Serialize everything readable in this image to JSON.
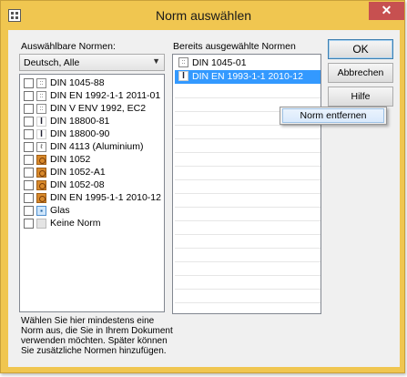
{
  "window": {
    "title": "Norm auswählen",
    "close_glyph": "✕"
  },
  "left_panel": {
    "label": "Auswählbare Normen:",
    "filter": {
      "value": "Deutsch, Alle"
    },
    "items": [
      {
        "label": "DIN 1045-88",
        "icon": "concrete-norm-icon"
      },
      {
        "label": "DIN EN 1992-1-1 2011-01",
        "icon": "concrete-norm-icon"
      },
      {
        "label": "DIN V ENV 1992, EC2",
        "icon": "concrete-norm-icon"
      },
      {
        "label": "DIN 18800-81",
        "icon": "steel-norm-icon"
      },
      {
        "label": "DIN 18800-90",
        "icon": "steel-norm-icon"
      },
      {
        "label": "DIN 4113 (Aluminium)",
        "icon": "aluminium-norm-icon"
      },
      {
        "label": "DIN 1052",
        "icon": "timber-norm-icon"
      },
      {
        "label": "DIN 1052-A1",
        "icon": "timber-norm-icon"
      },
      {
        "label": "DIN 1052-08",
        "icon": "timber-norm-icon"
      },
      {
        "label": "DIN EN 1995-1-1 2010-12",
        "icon": "timber-norm-icon"
      },
      {
        "label": "Glas",
        "icon": "glass-norm-icon"
      },
      {
        "label": "Keine Norm",
        "icon": "no-norm-icon"
      }
    ],
    "help_text": "Wählen Sie hier mindestens eine Norm aus, die Sie in Ihrem Dokument verwenden möchten. Später können Sie zusätzliche Normen hinzufügen."
  },
  "right_panel": {
    "label": "Bereits ausgewählte Normen",
    "items": [
      {
        "label": "DIN 1045-01",
        "icon": "concrete-norm-icon",
        "selected": false
      },
      {
        "label": "DIN EN 1993-1-1 2010-12",
        "icon": "steel-norm-icon",
        "selected": true
      }
    ]
  },
  "buttons": {
    "ok": "OK",
    "cancel": "Abbrechen",
    "help_partial": "Hilfe"
  },
  "context_menu": {
    "items": [
      {
        "label": "Norm entfernen"
      }
    ]
  },
  "colors": {
    "title_bar": "#f0c650",
    "close_button": "#c75050",
    "selection": "#3399ff"
  }
}
